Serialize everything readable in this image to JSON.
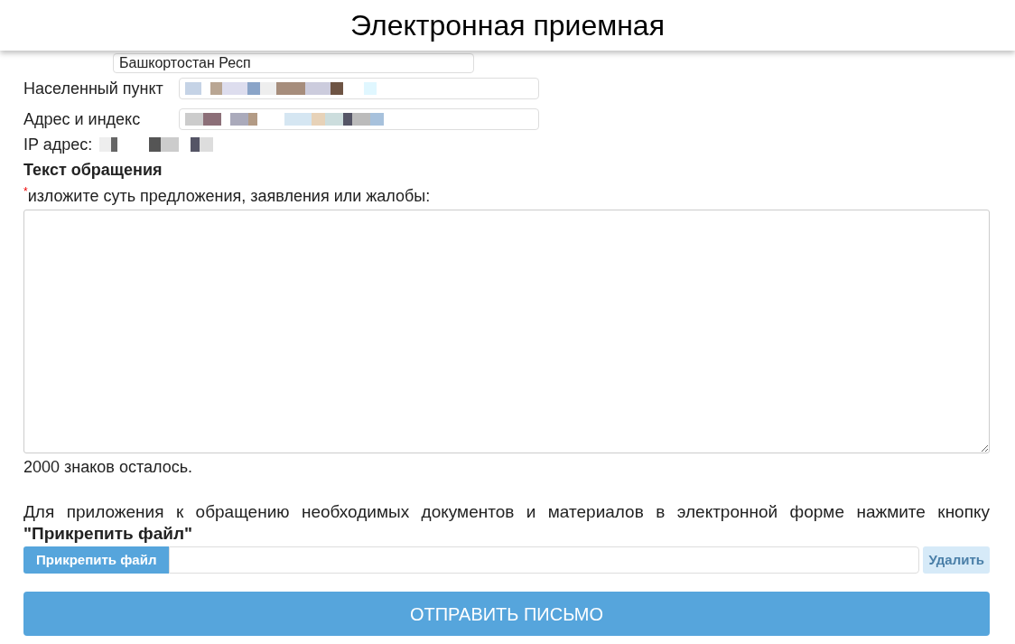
{
  "header": {
    "title": "Электронная приемная"
  },
  "subject_field": {
    "value": "Башкортостан Респ"
  },
  "locality": {
    "label": "Населенный пункт"
  },
  "address": {
    "label": "Адрес и индекс"
  },
  "ip": {
    "label": "IP адрес:"
  },
  "message": {
    "heading": "Текст обращения",
    "required_mark": "*",
    "prompt": "изложите суть предложения, заявления или жалобы:",
    "counter": "2000 знаков осталось."
  },
  "attachment": {
    "note": "Для приложения к обращению необходимых документов и материалов в электронной форме нажмите кнопку **\"Прикрепить файл\"**",
    "attach_button": "Прикрепить файл",
    "delete_button": {
      "label": "Удалить",
      "disabled": true
    }
  },
  "submit_button": "ОТПРАВИТЬ ПИСЬМО"
}
